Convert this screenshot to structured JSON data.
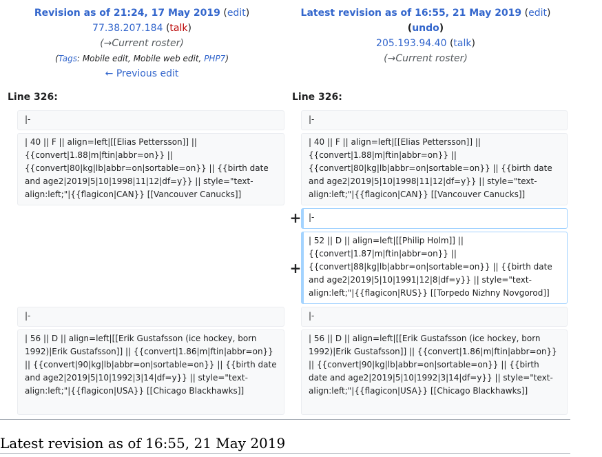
{
  "old": {
    "title": "Revision as of 21:24, 17 May 2019",
    "edit_label": "edit",
    "user": "77.38.207.184",
    "talk_label": "talk",
    "comment": "→Current roster",
    "tags_label": "Tags",
    "tags": [
      "Mobile edit",
      "Mobile web edit",
      "PHP7"
    ],
    "prev_edit_label": "← Previous edit"
  },
  "new": {
    "title": "Latest revision as of 16:55, 21 May 2019",
    "edit_label": "edit",
    "undo_label": "undo",
    "user": "205.193.94.40",
    "talk_label": "talk",
    "comment": "→Current roster"
  },
  "diff": {
    "left_line_label": "Line 326:",
    "right_line_label": "Line 326:",
    "added_marker": "+",
    "rows": {
      "r1_left": "|-",
      "r1_right": "|-",
      "r2_left": "| 40 || F || align=left|[[Elias Pettersson]] || {{convert|1.88|m|ftin|abbr=on}} || {{convert|80|kg|lb|abbr=on|sortable=on}} || {{birth date and age2|2019|5|10|1998|11|12|df=y}} || style=\"text-align:left;\"|{{flagicon|CAN}} [[Vancouver Canucks]]",
      "r2_right": "| 40 || F || align=left|[[Elias Pettersson]] || {{convert|1.88|m|ftin|abbr=on}} || {{convert|80|kg|lb|abbr=on|sortable=on}} || {{birth date and age2|2019|5|10|1998|11|12|df=y}} || style=\"text-align:left;\"|{{flagicon|CAN}} [[Vancouver Canucks]]",
      "add1": "|-",
      "add2": "| 52 || D || align=left|[[Philip Holm]] || {{convert|1.87|m|ftin|abbr=on}} || {{convert|88|kg|lb|abbr=on|sortable=on}} || {{birth date and age2|2019|5|10|1991|12|8|df=y}} || style=\"text-align:left;\"|{{flagicon|RUS}} [[Torpedo Nizhny Novgorod]]",
      "r3_left": "|-",
      "r3_right": "|-",
      "r4_left": "| 56 || D || align=left|[[Erik Gustafsson (ice hockey, born 1992)|Erik Gustafsson]] || {{convert|1.86|m|ftin|abbr=on}} || {{convert|90|kg|lb|abbr=on|sortable=on}} || {{birth date and age2|2019|5|10|1992|3|14|df=y}} || style=\"text-align:left;\"|{{flagicon|USA}} [[Chicago Blackhawks]]",
      "r4_right": "| 56 || D || align=left|[[Erik Gustafsson (ice hockey, born 1992)|Erik Gustafsson]] || {{convert|1.86|m|ftin|abbr=on}} || {{convert|90|kg|lb|abbr=on|sortable=on}} || {{birth date and age2|2019|5|10|1992|3|14|df=y}} || style=\"text-align:left;\"|{{flagicon|USA}} [[Chicago Blackhawks]]"
    }
  },
  "bottom_heading": "Latest revision as of 16:55, 21 May 2019"
}
